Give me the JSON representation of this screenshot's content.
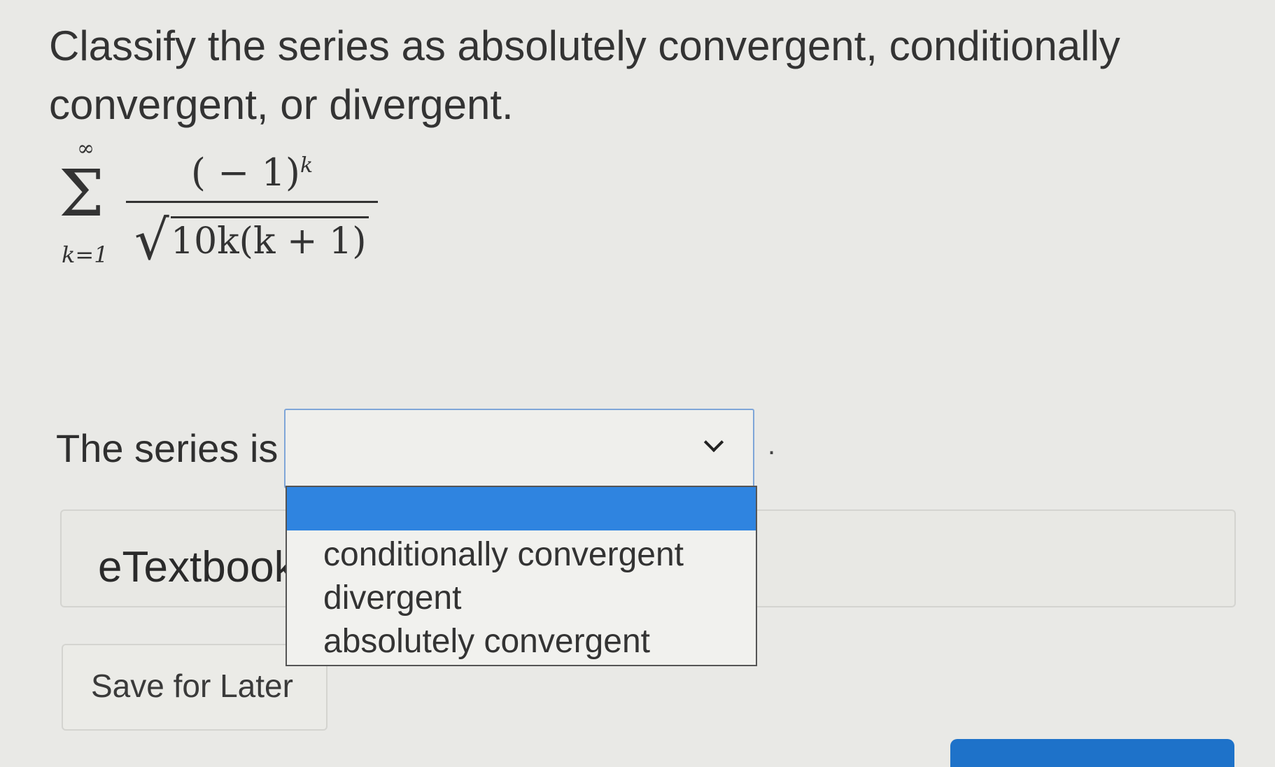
{
  "question": {
    "text": "Classify the series as absolutely convergent, conditionally convergent, or divergent."
  },
  "formula": {
    "upper_limit": "∞",
    "lower_limit": "k=1",
    "sigma": "Σ",
    "numerator_base": "( − 1)",
    "numerator_exponent": "k",
    "root_symbol": "√",
    "radicand": "10k(k + 1)"
  },
  "answer": {
    "prefix": "The series is",
    "selected_value": "",
    "suffix": ".",
    "options": [
      "",
      "conditionally convergent",
      "divergent",
      "absolutely convergent"
    ]
  },
  "panels": {
    "etextbook_label": "eTextbook",
    "save_label": "Save for Later"
  },
  "colors": {
    "highlight": "#2f84e0",
    "select_border": "#7fa6d8",
    "primary_button": "#1e72c9"
  }
}
